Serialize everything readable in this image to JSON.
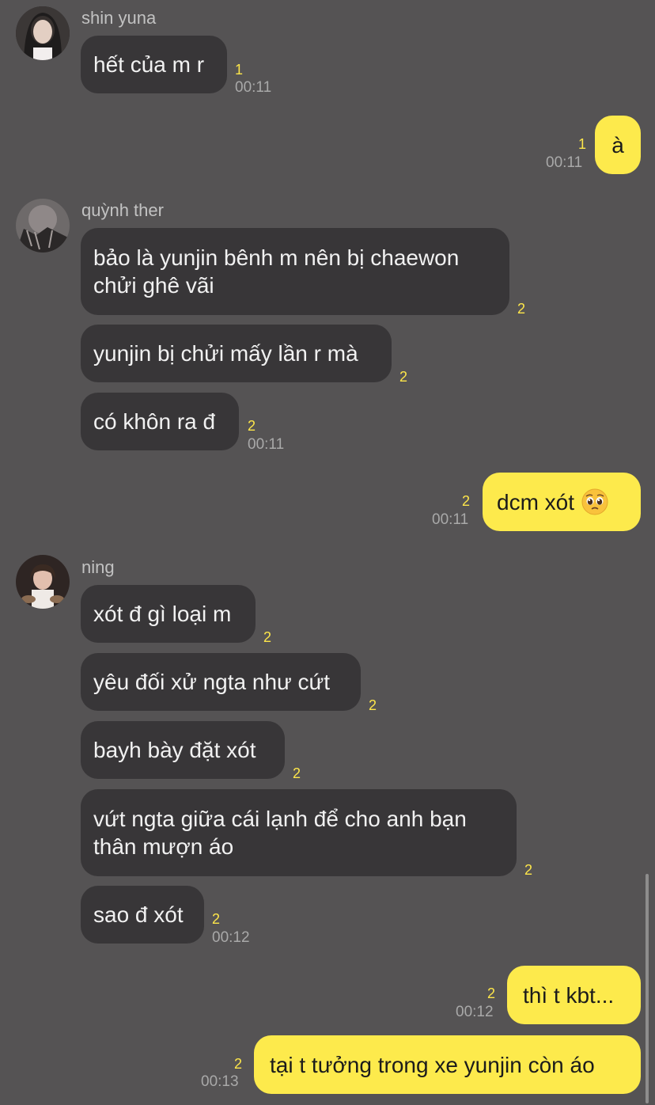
{
  "groups": [
    {
      "sender": "shin yuna"
    },
    {
      "sender": "quỳnh ther"
    },
    {
      "sender": "ning"
    }
  ],
  "messages": [
    {
      "text": "hết của m r",
      "count": "1",
      "time": "00:11"
    },
    {
      "text": "à",
      "count": "1",
      "time": "00:11"
    },
    {
      "text": "bảo là yunjin bênh m nên bị chaewon chửi ghê vãi",
      "count": "2"
    },
    {
      "text": "yunjin bị chửi mấy lần r mà",
      "count": "2"
    },
    {
      "text": "có khôn ra đ",
      "count": "2",
      "time": "00:11"
    },
    {
      "text": "dcm xót",
      "emoji": "pleading-face-emoji",
      "count": "2",
      "time": "00:11"
    },
    {
      "text": "xót đ gì loại m",
      "count": "2"
    },
    {
      "text": "yêu đối xử ngta như cứt",
      "count": "2"
    },
    {
      "text": "bayh bày đặt xót",
      "count": "2"
    },
    {
      "text": "vứt ngta giữa cái lạnh để cho anh bạn thân mượn áo",
      "count": "2"
    },
    {
      "text": "sao đ xót",
      "count": "2",
      "time": "00:12"
    },
    {
      "text": "thì t kbt...",
      "count": "2",
      "time": "00:12"
    },
    {
      "text": "tại t tưởng trong xe yunjin còn áo",
      "count": "2",
      "time": "00:13"
    }
  ],
  "colors": {
    "background": "#555354",
    "incoming_bubble": "#383638",
    "outgoing_bubble": "#fdea4c",
    "unread_count": "#fde64a",
    "timestamp": "#a9a9a9"
  }
}
